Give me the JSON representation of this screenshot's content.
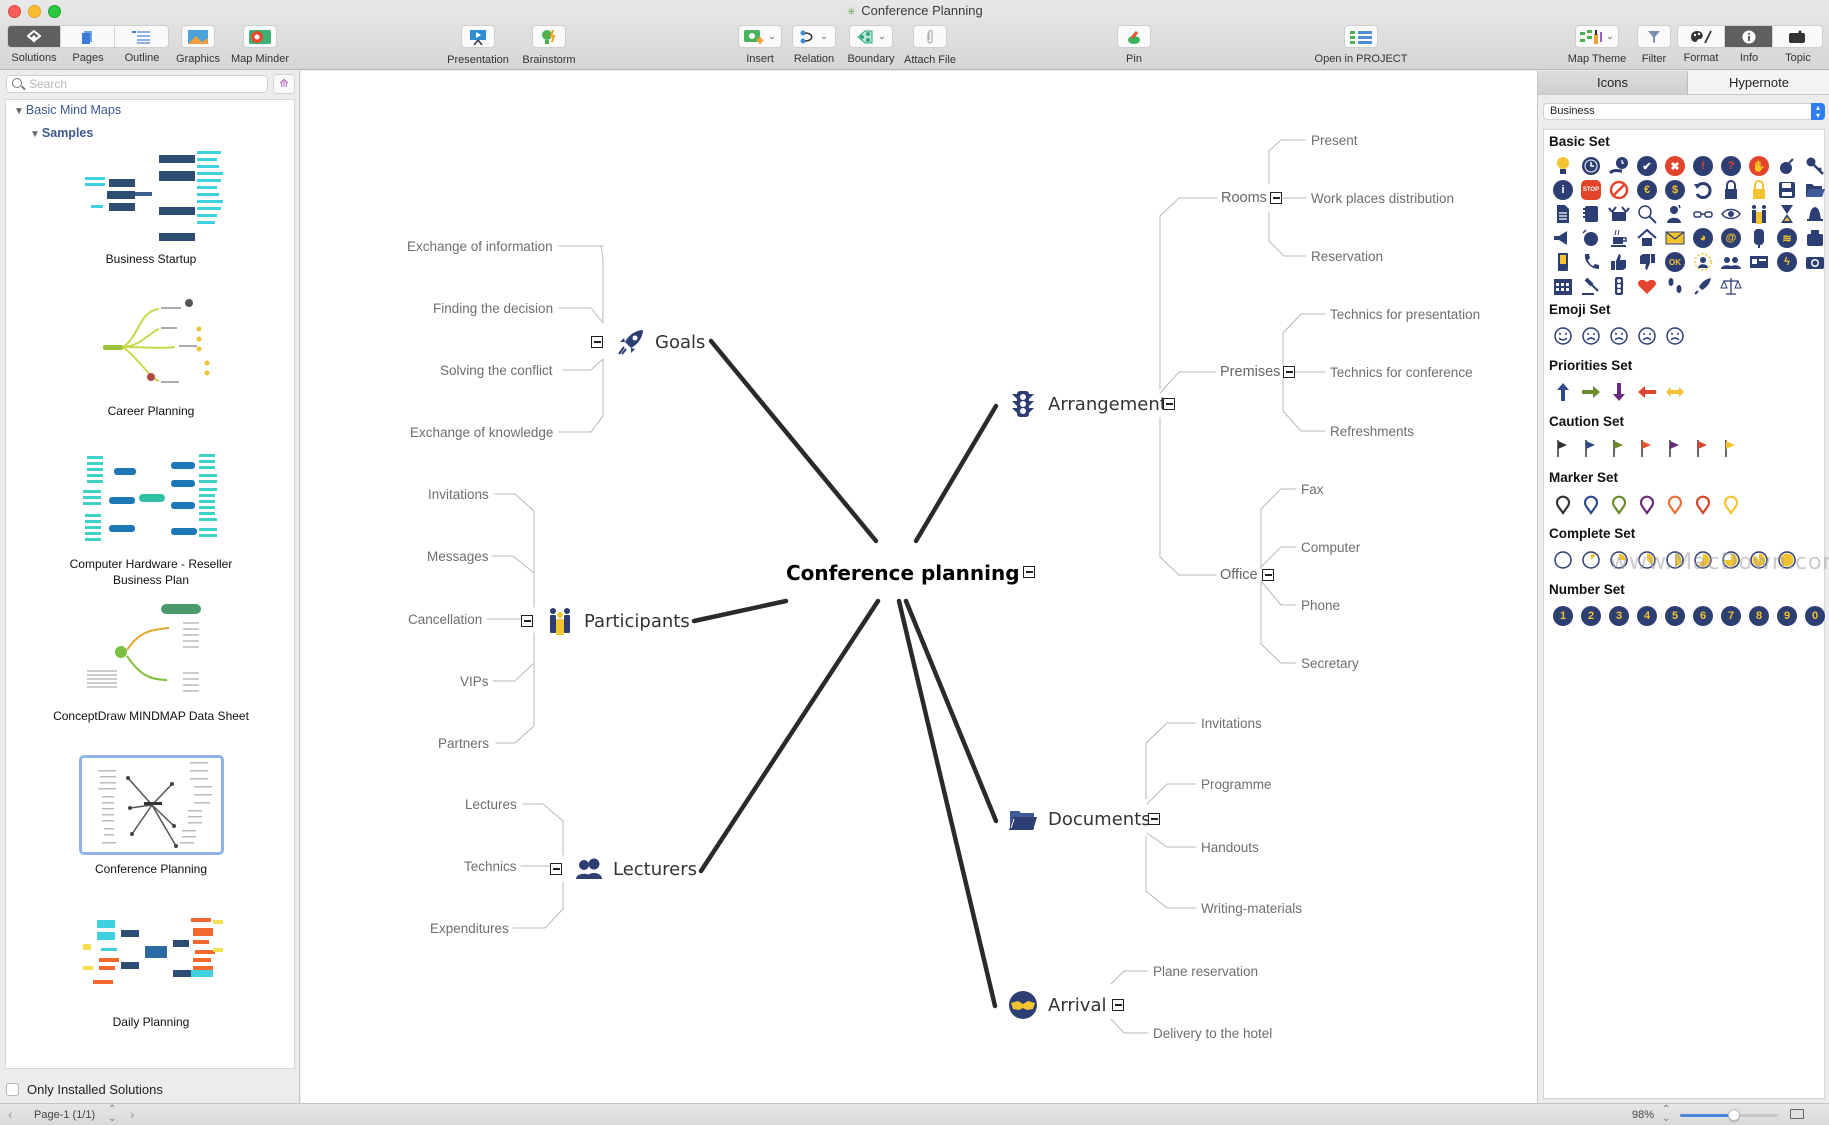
{
  "window": {
    "title": "Conference Planning"
  },
  "toolbar": {
    "left_segment": [
      "Solutions",
      "Pages",
      "Outline"
    ],
    "graphics": "Graphics",
    "map_minder": "Map Minder",
    "presentation": "Presentation",
    "brainstorm": "Brainstorm",
    "insert": "Insert",
    "relation": "Relation",
    "boundary": "Boundary",
    "attach_file": "Attach File",
    "pin": "Pin",
    "open_in_project": "Open in PROJECT",
    "map_theme": "Map Theme",
    "filter": "Filter",
    "right_segment": [
      "Format",
      "Info",
      "Topic"
    ],
    "active_left": "Solutions",
    "active_right": "Info"
  },
  "sidebar": {
    "search_placeholder": "Search",
    "tree_root": "Basic Mind Maps",
    "tree_child": "Samples",
    "samples": [
      {
        "name": "Business Startup",
        "selected": false
      },
      {
        "name": "Career Planning",
        "selected": false
      },
      {
        "name": "Computer Hardware - Reseller Business Plan",
        "selected": false
      },
      {
        "name": "ConceptDraw MINDMAP Data Sheet",
        "selected": false
      },
      {
        "name": "Conference Planning",
        "selected": true
      },
      {
        "name": "Daily Planning",
        "selected": false
      }
    ],
    "only_installed_label": "Only Installed Solutions",
    "only_installed_checked": false
  },
  "mindmap": {
    "central": "Conference planning",
    "topics": {
      "goals": {
        "label": "Goals",
        "icon": "rocket-icon",
        "children": [
          "Exchange of information",
          "Finding the decision",
          "Solving the conflict",
          "Exchange of knowledge"
        ]
      },
      "participants": {
        "label": "Participants",
        "icon": "people-icon",
        "children": [
          "Invitations",
          "Messages",
          "Cancellation",
          "VIPs",
          "Partners"
        ]
      },
      "lecturers": {
        "label": "Lecturers",
        "icon": "group-icon",
        "children": [
          "Lectures",
          "Technics",
          "Expenditures"
        ]
      },
      "arrangement": {
        "label": "Arrangement",
        "icon": "traffic-light-icon",
        "subtopics": [
          {
            "label": "Rooms",
            "children": [
              "Present",
              "Work places distribution",
              "Reservation"
            ]
          },
          {
            "label": "Premises",
            "children": [
              "Technics for presentation",
              "Technics for conference",
              "Refreshments"
            ]
          },
          {
            "label": "Office",
            "children": [
              "Fax",
              "Computer",
              "Phone",
              "Secretary"
            ]
          }
        ]
      },
      "documents": {
        "label": "Documents",
        "icon": "folder-icon",
        "children": [
          "Invitations",
          "Programme",
          "Handouts",
          "Writing-materials"
        ]
      },
      "arrival": {
        "label": "Arrival",
        "icon": "handshake-icon",
        "children": [
          "Plane reservation",
          "Delivery to the hotel"
        ]
      }
    }
  },
  "right_panel": {
    "tabs": [
      "Icons",
      "Hypernote"
    ],
    "active_tab": "Icons",
    "theme": "Business",
    "sets": [
      {
        "title": "Basic Set"
      },
      {
        "title": "Emoji Set"
      },
      {
        "title": "Priorities Set"
      },
      {
        "title": "Caution Set"
      },
      {
        "title": "Marker Set"
      },
      {
        "title": "Complete Set"
      },
      {
        "title": "Number Set"
      }
    ],
    "number_set": [
      "1",
      "2",
      "3",
      "4",
      "5",
      "6",
      "7",
      "8",
      "9",
      "0"
    ],
    "watermark": "www.MacDown.com"
  },
  "statusbar": {
    "page": "Page-1 (1/1)",
    "zoom": "98%",
    "zoom_fraction": 0.55
  },
  "colors": {
    "icon_navy": "#2d3e73",
    "icon_yellow": "#f4c430",
    "icon_red": "#e2452b",
    "selection_blue": "#8fb3e8",
    "slider_blue": "#4a87d9"
  }
}
